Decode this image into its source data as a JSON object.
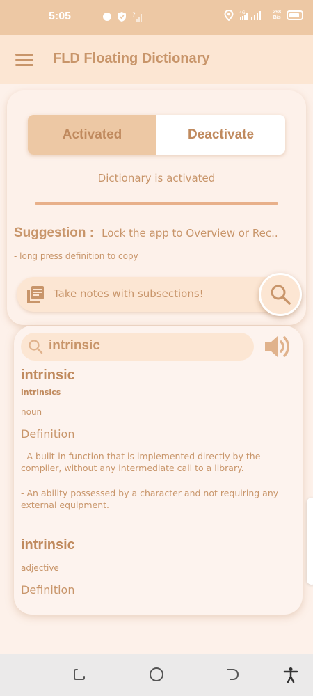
{
  "status_bar": {
    "time": "5:05",
    "net_speed_top": "298",
    "net_speed_bottom": "B/s",
    "icons": [
      "whatsapp-icon",
      "shield-icon",
      "no-signal-icon",
      "location-icon",
      "signal-icon",
      "battery-icon"
    ]
  },
  "app_bar": {
    "title": "FLD Floating Dictionary",
    "menu_icon": "hamburger-menu-icon"
  },
  "toggle": {
    "activated_label": "Activated",
    "deactivate_label": "Deactivate",
    "selected": "Activated"
  },
  "status_message": "Dictionary is activated",
  "suggestion": {
    "label": "Suggestion :",
    "text": "Lock the app to Overview or Rec.."
  },
  "hint": "- long press definition to copy",
  "notes_bar": {
    "text": "Take notes with subsections!",
    "icon": "notes-library-icon"
  },
  "search": {
    "query": "intrinsic",
    "icon": "search-icon"
  },
  "entries": [
    {
      "word": "intrinsic",
      "form": "intrinsics",
      "part_of_speech": "noun",
      "definition_heading": "Definition",
      "definitions": [
        "- A built-in function that is implemented directly by the compiler, without any intermediate call to a library.",
        "- An ability possessed by a character and not requiring any external equipment."
      ]
    },
    {
      "word": "intrinsic",
      "part_of_speech": "adjective",
      "definition_heading": "Definition"
    }
  ],
  "nav_bar": {
    "items": [
      "recent-apps-icon",
      "home-icon",
      "back-icon",
      "accessibility-icon"
    ]
  },
  "colors": {
    "accent": "#c8956a",
    "status_bar": "#edc8a4",
    "app_bar": "#fce6d3",
    "background": "#fdf1ea"
  }
}
